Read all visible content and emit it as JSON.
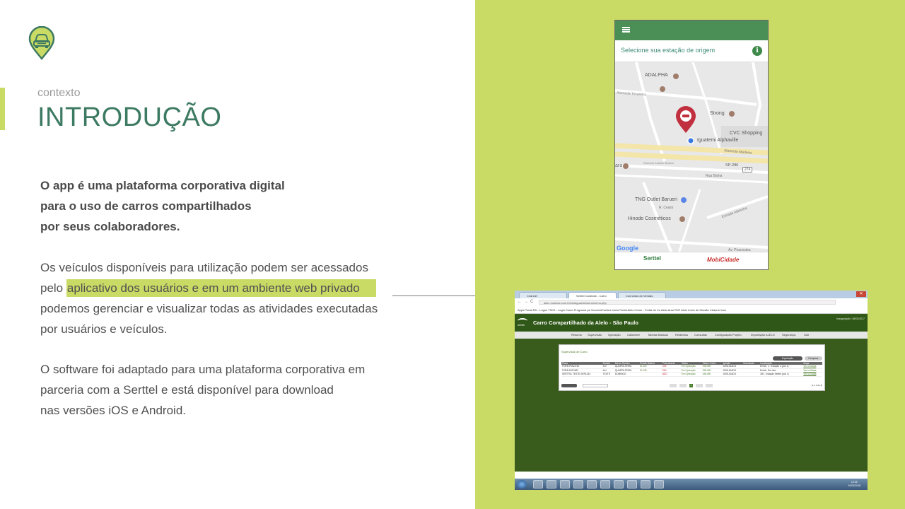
{
  "slide": {
    "subtitle": "contexto",
    "title": "INTRODUÇÃO",
    "intro_lines": [
      "O app é uma plataforma corporativa digital",
      "para o uso de carros compartilhados",
      "por seus colaboradores."
    ],
    "para2": {
      "line1": "Os veículos disponíveis para utilização podem ser acessados",
      "line2_prefix": "pelo",
      "line2_highlight": "aplicativo dos usuários e em um ambiente web privado",
      "line3": "podemos gerenciar e visualizar todas as atividades executadas",
      "line4": "por usuários e veículos."
    },
    "para3_lines": [
      "O software foi adaptado para uma plataforma corporativa em",
      "parceria com a Serttel e está disponível para download",
      "nas versões iOS e Android."
    ],
    "colors": {
      "accent": "#c9da65",
      "title": "#3d7a62"
    }
  },
  "phone": {
    "station_prompt": "Selecione sua estação de origem",
    "map_labels": {
      "adalpha": "ADALPHA",
      "tocantins": "Alameda Tocantins",
      "strong": "Strong",
      "cvc": "CVC Shopping",
      "iguatemi": "Iguatemi Alphaville",
      "madeira": "Alameda Madeira",
      "sp280": "SP-280",
      "n274": "274",
      "ara": "ara",
      "bahia": "Rua Bahia",
      "castelo": "Rodovia Castelo Branco",
      "tng": "TNG Outlet Barueri",
      "ceara": "R. Ceará",
      "aldeia": "Estrada Aldeinha",
      "hinode": "Hinode Cosméticos",
      "piracicaba": "Av. Piracicaba",
      "google": "Google"
    },
    "footer_brand": "Serttel",
    "footer_logo": "MobiCidade"
  },
  "desktop": {
    "tabs": [
      "Channel",
      "Serttel Carshare - Carro",
      "Connexão de Vendas"
    ],
    "url": "alelo.mobicar.com.br/vielaguarda/menu/menu.php",
    "bookmarks": "Apps   Portal RH - Logon   TSC2 - Login   Curso Programa pa   SuccessFactors Início   Portal Alelo   Home - Portal do Co   Alelo Auto   RNF Alelo   Início de Sessão   Channel   icon",
    "app_title": "Carro Compartilhado da Alelo - São Paulo",
    "user": "Inauguração / 48/03/2017",
    "logo_text": "Serttel",
    "menu": [
      "Resumo",
      "Supervisão",
      "Operação",
      "Callcenter",
      "Tabelas Básicas",
      "Relatórios",
      "Consultas",
      "Configuração Projeto",
      "Importação ALELO",
      "Segurança",
      "Sair"
    ],
    "card_title": "Supervisão de Carro",
    "btn_export": "Exportação",
    "btn_search": "Pesquisar",
    "table_headers": [
      "Placa",
      "Modelo",
      "Dia do Rodízio",
      "Tensão Bateria",
      "Porta Aberta",
      "Status",
      "Status Online",
      "Ignição",
      "Velocidade",
      "Localização",
      "",
      "Mapa"
    ],
    "table_rows": [
      [
        "FORD-PMA4745",
        "Ka+",
        "QUARTA-FEIRA",
        "12.306",
        "SIM",
        "Em Operação",
        "ONLINE",
        "DESLIGADO",
        "",
        "Enrich. 1 - Estação 1 (pos 1)",
        "",
        "Ver no Mapa"
      ],
      [
        "FORD-FAP1657",
        "Ka+",
        "QUARTA-FEIRA",
        "12.135",
        "SIM",
        "Em Operação",
        "ONLINE",
        "DESLIGADO",
        "",
        "Enrich. Em Uso",
        "",
        "Ver no Mapa"
      ],
      [
        "SERTTEL TESTE-SER1234",
        "TESTE",
        "DOMINGO",
        "",
        "NÃO",
        "Em Operação",
        "ONLINE",
        "DESLIGADO",
        "",
        "300 - Estação Serttel (pos 1)",
        "",
        "Ver no Mapa"
      ]
    ],
    "pager_info": "[1 a 3 de 3]",
    "page_num": "1",
    "clock_time": "13:26",
    "clock_date": "10/02/2018"
  }
}
